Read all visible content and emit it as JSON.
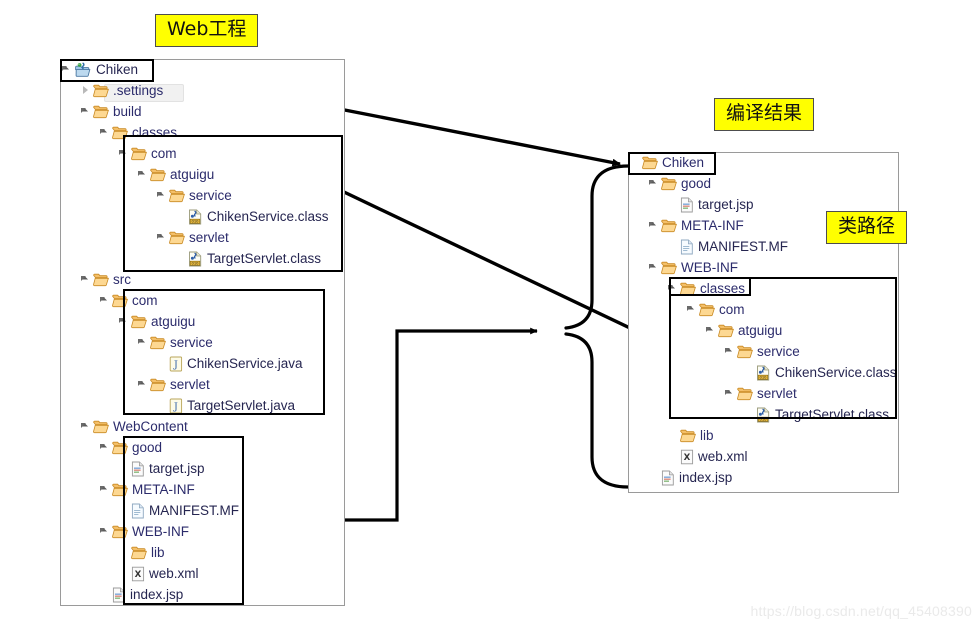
{
  "callouts": {
    "web_project": "Web工程",
    "compile_result": "编译结果",
    "class_path": "类路径"
  },
  "watermark": "https://blog.csdn.net/qq_45408390",
  "left_panel": {
    "name": "eclipse-project-explorer-source",
    "rows": [
      {
        "label": "Chiken",
        "indent": 0,
        "icon": "java-web-project-icon",
        "twisty": "open"
      },
      {
        "label": ".settings",
        "indent": 1,
        "icon": "folder-icon",
        "twisty": "closed"
      },
      {
        "label": "build",
        "indent": 1,
        "icon": "folder-icon",
        "twisty": "open"
      },
      {
        "label": "classes",
        "indent": 2,
        "icon": "folder-icon",
        "twisty": "open"
      },
      {
        "label": "com",
        "indent": 3,
        "icon": "folder-icon",
        "twisty": "open"
      },
      {
        "label": "atguigu",
        "indent": 4,
        "icon": "folder-icon",
        "twisty": "open"
      },
      {
        "label": "service",
        "indent": 5,
        "icon": "folder-icon",
        "twisty": "open"
      },
      {
        "label": "ChikenService.class",
        "indent": 6,
        "icon": "class-file-icon",
        "twisty": "none"
      },
      {
        "label": "servlet",
        "indent": 5,
        "icon": "folder-icon",
        "twisty": "open"
      },
      {
        "label": "TargetServlet.class",
        "indent": 6,
        "icon": "class-file-icon",
        "twisty": "none"
      },
      {
        "label": "src",
        "indent": 1,
        "icon": "folder-icon",
        "twisty": "open"
      },
      {
        "label": "com",
        "indent": 2,
        "icon": "folder-icon",
        "twisty": "open"
      },
      {
        "label": "atguigu",
        "indent": 3,
        "icon": "folder-icon",
        "twisty": "open"
      },
      {
        "label": "service",
        "indent": 4,
        "icon": "folder-icon",
        "twisty": "open"
      },
      {
        "label": "ChikenService.java",
        "indent": 5,
        "icon": "java-file-icon",
        "twisty": "none"
      },
      {
        "label": "servlet",
        "indent": 4,
        "icon": "folder-icon",
        "twisty": "open"
      },
      {
        "label": "TargetServlet.java",
        "indent": 5,
        "icon": "java-file-icon",
        "twisty": "none"
      },
      {
        "label": "WebContent",
        "indent": 1,
        "icon": "folder-icon",
        "twisty": "open"
      },
      {
        "label": "good",
        "indent": 2,
        "icon": "folder-icon",
        "twisty": "open"
      },
      {
        "label": "target.jsp",
        "indent": 3,
        "icon": "jsp-file-icon",
        "twisty": "none"
      },
      {
        "label": "META-INF",
        "indent": 2,
        "icon": "folder-icon",
        "twisty": "open"
      },
      {
        "label": "MANIFEST.MF",
        "indent": 3,
        "icon": "text-file-icon",
        "twisty": "none"
      },
      {
        "label": "WEB-INF",
        "indent": 2,
        "icon": "folder-icon",
        "twisty": "open"
      },
      {
        "label": "lib",
        "indent": 3,
        "icon": "folder-icon",
        "twisty": "none"
      },
      {
        "label": "web.xml",
        "indent": 3,
        "icon": "xml-file-icon",
        "twisty": "none"
      },
      {
        "label": "index.jsp",
        "indent": 2,
        "icon": "jsp-file-icon",
        "twisty": "none"
      }
    ]
  },
  "right_panel": {
    "name": "deployed-output-tree",
    "rows": [
      {
        "label": "Chiken",
        "indent": 0,
        "icon": "folder-icon",
        "twisty": "none"
      },
      {
        "label": "good",
        "indent": 1,
        "icon": "folder-icon",
        "twisty": "open"
      },
      {
        "label": "target.jsp",
        "indent": 2,
        "icon": "jsp-file-icon",
        "twisty": "none"
      },
      {
        "label": "META-INF",
        "indent": 1,
        "icon": "folder-icon",
        "twisty": "open"
      },
      {
        "label": "MANIFEST.MF",
        "indent": 2,
        "icon": "text-file-icon",
        "twisty": "none"
      },
      {
        "label": "WEB-INF",
        "indent": 1,
        "icon": "folder-icon",
        "twisty": "open"
      },
      {
        "label": "classes",
        "indent": 2,
        "icon": "folder-icon",
        "twisty": "open"
      },
      {
        "label": "com",
        "indent": 3,
        "icon": "folder-icon",
        "twisty": "open"
      },
      {
        "label": "atguigu",
        "indent": 4,
        "icon": "folder-icon",
        "twisty": "open"
      },
      {
        "label": "service",
        "indent": 5,
        "icon": "folder-icon",
        "twisty": "open"
      },
      {
        "label": "ChikenService.class",
        "indent": 6,
        "icon": "class-file-icon",
        "twisty": "none"
      },
      {
        "label": "servlet",
        "indent": 5,
        "icon": "folder-icon",
        "twisty": "open"
      },
      {
        "label": "TargetServlet.class",
        "indent": 6,
        "icon": "class-file-icon",
        "twisty": "none"
      },
      {
        "label": "lib",
        "indent": 2,
        "icon": "folder-icon",
        "twisty": "none"
      },
      {
        "label": "web.xml",
        "indent": 2,
        "icon": "xml-file-icon",
        "twisty": "none"
      },
      {
        "label": "index.jsp",
        "indent": 1,
        "icon": "jsp-file-icon",
        "twisty": "none"
      }
    ]
  },
  "colors": {
    "highlight_yellow": "#ffff00",
    "folder_orange": "#e8a33d",
    "tree_text": "#2b2b6b",
    "arrow_black": "#000000",
    "panel_border": "#9a9a9a"
  }
}
